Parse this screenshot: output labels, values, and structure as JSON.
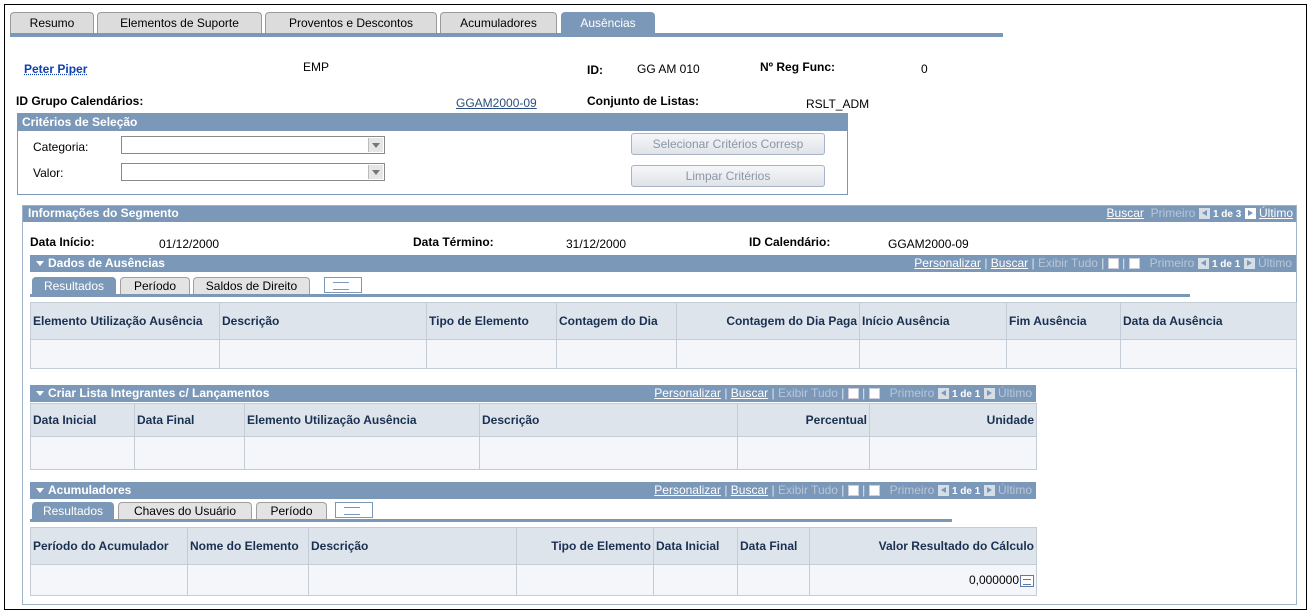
{
  "page_tabs": [
    "Resumo",
    "Elementos de Suporte",
    "Proventos e Descontos",
    "Acumuladores",
    "Ausências"
  ],
  "header": {
    "name": "Peter Piper",
    "emp_label": "EMP",
    "id_label": "ID:",
    "id_value": "GG AM 010",
    "reg_label": "Nº Reg Func:",
    "reg_value": "0",
    "cal_group_label": "ID Grupo Calendários:",
    "cal_group_value": "GGAM2000-09",
    "list_set_label": "Conjunto de Listas:",
    "list_set_value": "RSLT_ADM"
  },
  "criteria": {
    "title": "Critérios de Seleção",
    "category_label": "Categoria:",
    "value_label": "Valor:",
    "select_button": "Selecionar Critérios Corresp",
    "clear_button": "Limpar Critérios"
  },
  "segment": {
    "title": "Informações do Segmento",
    "nav": {
      "search": "Buscar",
      "first": "Primeiro",
      "count": "1 de 3",
      "last": "Último"
    },
    "start_label": "Data Início:",
    "start_value": "01/12/2000",
    "end_label": "Data Término:",
    "end_value": "31/12/2000",
    "cal_label": "ID Calendário:",
    "cal_value": "GGAM2000-09"
  },
  "absences": {
    "title": "Dados de Ausências",
    "nav": {
      "personalize": "Personalizar",
      "search": "Buscar",
      "view_all": "Exibir Tudo",
      "first": "Primeiro",
      "count": "1 de 1",
      "last": "Último"
    },
    "tabs": [
      "Resultados",
      "Período",
      "Saldos de Direito"
    ],
    "columns": [
      "Elemento Utilização Ausência",
      "Descrição",
      "Tipo de Elemento",
      "Contagem do Dia",
      "Contagem do Dia Paga",
      "Início Ausência",
      "Fim Ausência",
      "Data da Ausência"
    ]
  },
  "members": {
    "title": "Criar Lista Integrantes c/ Lançamentos",
    "nav": {
      "personalize": "Personalizar",
      "search": "Buscar",
      "view_all": "Exibir Tudo",
      "first": "Primeiro",
      "count": "1 de 1",
      "last": "Último"
    },
    "columns": [
      "Data Inicial",
      "Data Final",
      "Elemento Utilização Ausência",
      "Descrição",
      "Percentual",
      "Unidade"
    ]
  },
  "accumulators": {
    "title": "Acumuladores",
    "nav": {
      "personalize": "Personalizar",
      "search": "Buscar",
      "view_all": "Exibir Tudo",
      "first": "Primeiro",
      "count": "1 de 1",
      "last": "Último"
    },
    "tabs": [
      "Resultados",
      "Chaves do Usuário",
      "Período"
    ],
    "columns": [
      "Período do Acumulador",
      "Nome do Elemento",
      "Descrição",
      "Tipo de Elemento",
      "Data Inicial",
      "Data Final",
      "Valor Resultado do Cálculo"
    ],
    "result_value": "0,000000"
  }
}
